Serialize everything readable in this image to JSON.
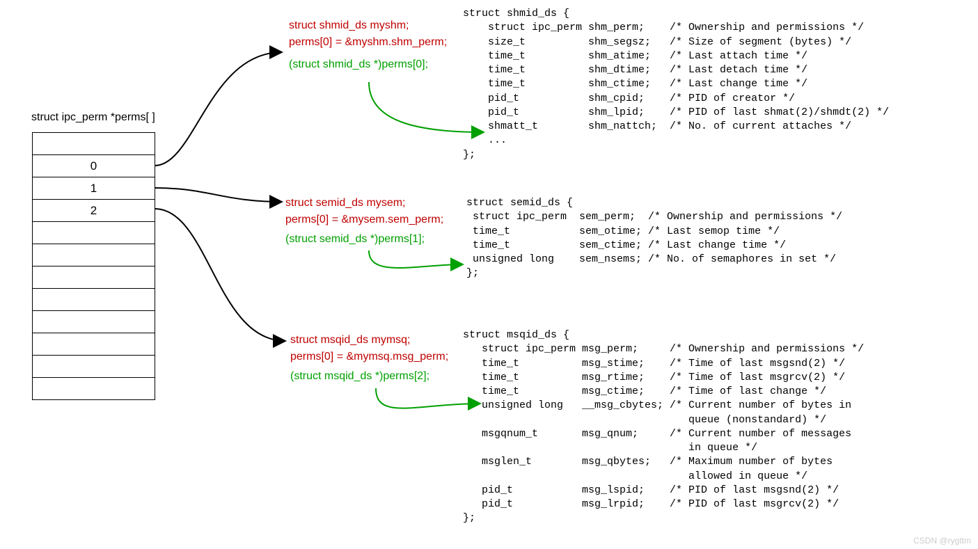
{
  "array_title": "struct ipc_perm *perms[ ]",
  "rows": [
    "",
    "0",
    "1",
    "2",
    "",
    "",
    "",
    "",
    "",
    "",
    "",
    "",
    ""
  ],
  "blk0": {
    "l1": "struct shmid_ds myshm;",
    "l2": "perms[0] = &myshm.shm_perm;",
    "l3": "(struct shmid_ds *)perms[0];"
  },
  "blk1": {
    "l1": "struct semid_ds mysem;",
    "l2": "perms[0] = &mysem.sem_perm;",
    "l3": "(struct semid_ds *)perms[1];"
  },
  "blk2": {
    "l1": "struct msqid_ds mymsq;",
    "l2": "perms[0] = &mymsq.msg_perm;",
    "l3": "(struct msqid_ds *)perms[2];"
  },
  "struct0": "struct shmid_ds {\n    struct ipc_perm shm_perm;    /* Ownership and permissions */\n    size_t          shm_segsz;   /* Size of segment (bytes) */\n    time_t          shm_atime;   /* Last attach time */\n    time_t          shm_dtime;   /* Last detach time */\n    time_t          shm_ctime;   /* Last change time */\n    pid_t           shm_cpid;    /* PID of creator */\n    pid_t           shm_lpid;    /* PID of last shmat(2)/shmdt(2) */\n    shmatt_t        shm_nattch;  /* No. of current attaches */\n    ...\n};",
  "struct1": "struct semid_ds {\n struct ipc_perm  sem_perm;  /* Ownership and permissions */\n time_t           sem_otime; /* Last semop time */\n time_t           sem_ctime; /* Last change time */\n unsigned long    sem_nsems; /* No. of semaphores in set */\n};",
  "struct2": "struct msqid_ds {\n   struct ipc_perm msg_perm;     /* Ownership and permissions */\n   time_t          msg_stime;    /* Time of last msgsnd(2) */\n   time_t          msg_rtime;    /* Time of last msgrcv(2) */\n   time_t          msg_ctime;    /* Time of last change */\n   unsigned long   __msg_cbytes; /* Current number of bytes in\n                                    queue (nonstandard) */\n   msgqnum_t       msg_qnum;     /* Current number of messages\n                                    in queue */\n   msglen_t        msg_qbytes;   /* Maximum number of bytes\n                                    allowed in queue */\n   pid_t           msg_lspid;    /* PID of last msgsnd(2) */\n   pid_t           msg_lrpid;    /* PID of last msgrcv(2) */\n};",
  "watermark": "CSDN @rygttm"
}
